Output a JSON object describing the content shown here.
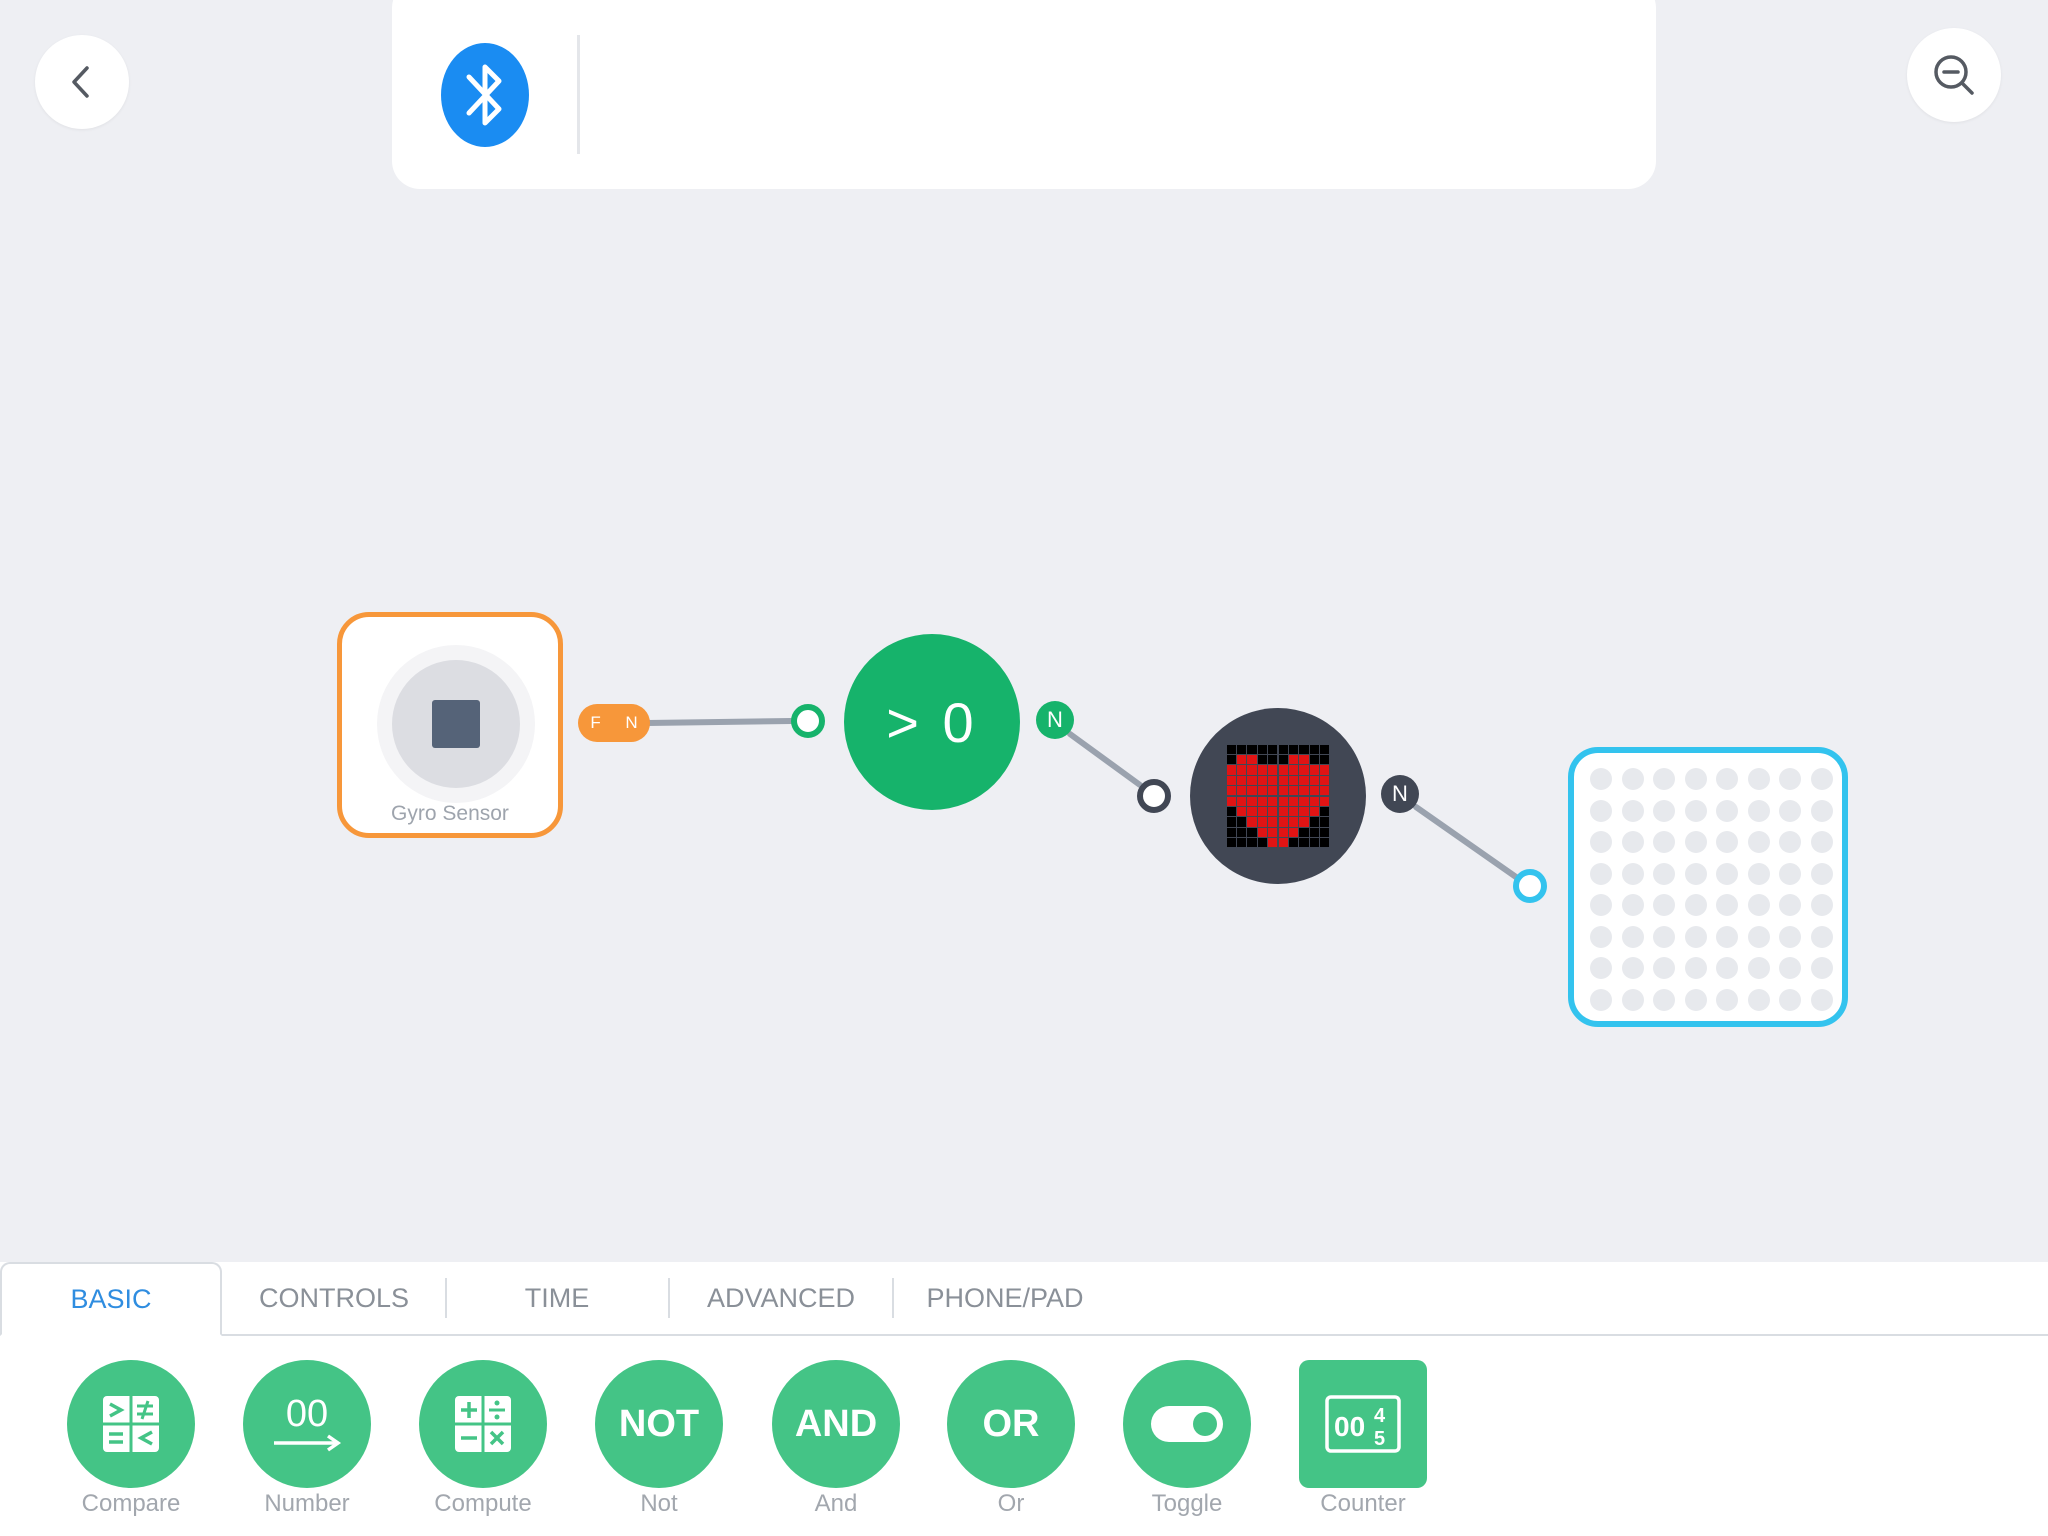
{
  "header": {
    "back_icon": "chevron-left-icon",
    "zoom_icon": "zoom-out-icon",
    "bluetooth_icon": "bluetooth-icon"
  },
  "canvas": {
    "gyro": {
      "label": "Gyro Sensor",
      "accent": "#f7973a"
    },
    "gyro_port": {
      "left": "F",
      "right": "N"
    },
    "compare": {
      "label": "> 0",
      "color": "#16b36b"
    },
    "compare_out": "N",
    "heart": {
      "color": "#414754",
      "pixel_on": "#e11414"
    },
    "heart_out": "N",
    "matrix": {
      "accent": "#33c3ee"
    }
  },
  "palette": {
    "tabs": [
      "BASIC",
      "CONTROLS",
      "TIME",
      "ADVANCED",
      "PHONE/PAD"
    ],
    "active_tab": "BASIC",
    "tools": [
      {
        "label": "Compare",
        "icon": "compare-icon"
      },
      {
        "label": "Number",
        "icon": "number-icon",
        "glyph": "00"
      },
      {
        "label": "Compute",
        "icon": "compute-icon"
      },
      {
        "label": "Not",
        "icon": "not-icon",
        "glyph": "NOT"
      },
      {
        "label": "And",
        "icon": "and-icon",
        "glyph": "AND"
      },
      {
        "label": "Or",
        "icon": "or-icon",
        "glyph": "OR"
      },
      {
        "label": "Toggle",
        "icon": "toggle-icon"
      },
      {
        "label": "Counter",
        "icon": "counter-icon",
        "glyph": "00"
      }
    ],
    "accent": "#44c486"
  }
}
